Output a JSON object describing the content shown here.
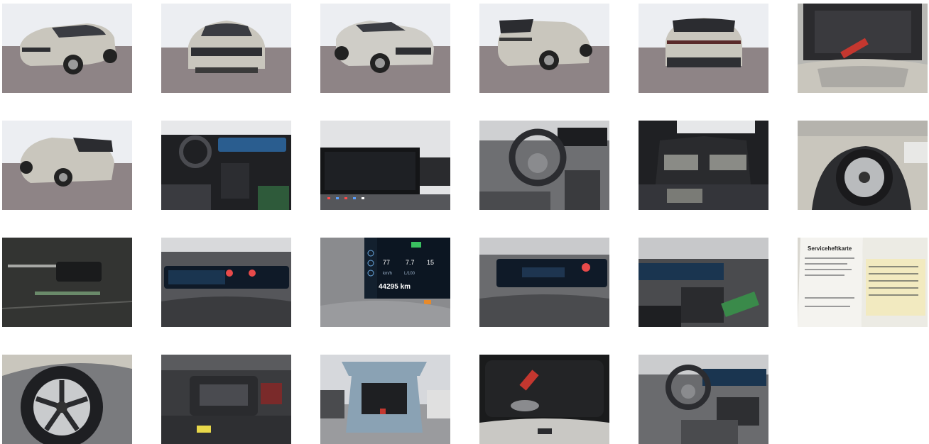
{
  "gallery": {
    "photos": [
      {
        "subject": "exterior-front-left"
      },
      {
        "subject": "exterior-front"
      },
      {
        "subject": "exterior-front-right"
      },
      {
        "subject": "exterior-rear-left"
      },
      {
        "subject": "exterior-rear"
      },
      {
        "subject": "trunk-open"
      },
      {
        "subject": "exterior-rear-left-2"
      },
      {
        "subject": "interior-dashboard"
      },
      {
        "subject": "infotainment-screen"
      },
      {
        "subject": "steering-wheel"
      },
      {
        "subject": "rear-seats"
      },
      {
        "subject": "wheel-arch"
      },
      {
        "subject": "windshield-vin"
      },
      {
        "subject": "instrument-cluster"
      },
      {
        "subject": "odometer",
        "odometer_text": "44295 km",
        "values": [
          "77",
          "7.7",
          "15"
        ],
        "units": [
          "km/h",
          "L/100"
        ]
      },
      {
        "subject": "instrument-cluster-2"
      },
      {
        "subject": "center-console"
      },
      {
        "subject": "service-booklet",
        "heading": "Serviceheftkarte"
      },
      {
        "subject": "wheel-tire"
      },
      {
        "subject": "engine-bay"
      },
      {
        "subject": "trunk-open-rear"
      },
      {
        "subject": "spare-wheel-well"
      },
      {
        "subject": "interior-driver-side"
      }
    ]
  },
  "colors": {
    "background": "#ffffff",
    "studio_wall": "#e8e9ee",
    "studio_floor": "#8e8486",
    "car_silver": "#c9c6bd",
    "car_dark": "#2e2f33",
    "interior_black": "#1f2023",
    "screen_blue": "#2a5d8f"
  }
}
